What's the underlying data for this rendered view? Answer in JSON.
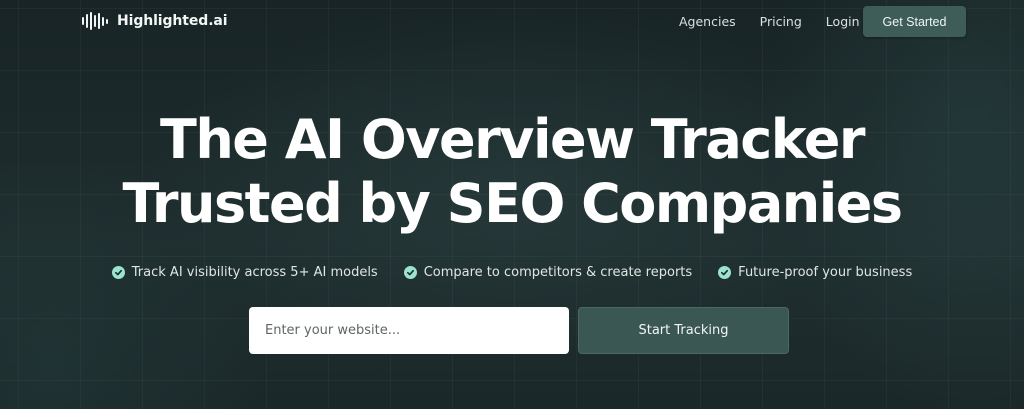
{
  "header": {
    "logo_text": "Highlighted.ai",
    "nav": {
      "agencies": "Agencies",
      "pricing": "Pricing",
      "login": "Login"
    },
    "cta_label": "Get Started"
  },
  "hero": {
    "title_line1": "The AI Overview Tracker",
    "title_line2": "Trusted by SEO Companies",
    "features": [
      "Track AI visibility across 5+ AI models",
      "Compare to competitors & create reports",
      "Future-proof your business"
    ],
    "input_placeholder": "Enter your website...",
    "submit_label": "Start Tracking"
  },
  "icons": {
    "logo": "sound-wave-icon",
    "feature": "check-circle-icon"
  },
  "colors": {
    "background": "#1c2a2b",
    "button": "#3e5c58",
    "check": "#9be3cf"
  }
}
